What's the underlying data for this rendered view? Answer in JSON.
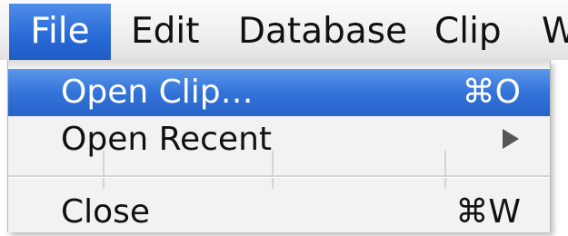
{
  "menubar": {
    "items": [
      {
        "label": "File",
        "active": true
      },
      {
        "label": "Edit",
        "active": false
      },
      {
        "label": "Database",
        "active": false
      },
      {
        "label": "Clip",
        "active": false
      },
      {
        "label": "W",
        "active": false
      }
    ]
  },
  "file_menu": {
    "items": [
      {
        "label": "Open Clip…",
        "shortcut": "⌘O",
        "highlighted": true
      },
      {
        "label": "Open Recent",
        "submenu_icon": "chevron-right-icon"
      },
      {
        "label": "Close",
        "shortcut": "⌘W"
      }
    ]
  },
  "colors": {
    "highlight": "#3373d9",
    "menu_background": "#f2f2f2"
  }
}
